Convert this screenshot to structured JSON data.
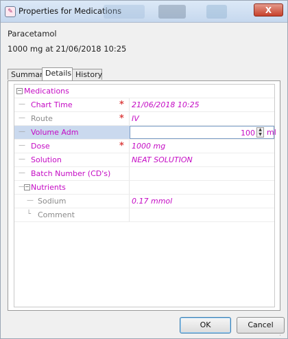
{
  "window": {
    "title": "Properties for Medications",
    "close_label": "X",
    "app_icon": "properties-icon"
  },
  "header": {
    "drug_name": "Paracetamol",
    "dose_summary": "1000 mg at 21/06/2018 10:25"
  },
  "tabs": [
    {
      "label": "Summary",
      "active": false
    },
    {
      "label": "Details",
      "active": true
    },
    {
      "label": "History",
      "active": false
    }
  ],
  "grid": {
    "medications_label": "Medications",
    "rows": [
      {
        "label": "Chart Time",
        "required": true,
        "value": "21/06/2018 10:25",
        "enabled": true
      },
      {
        "label": "Route",
        "required": true,
        "value": "IV",
        "enabled": false
      },
      {
        "label": "Volume Adm",
        "required": false,
        "value": "100",
        "unit": "ml",
        "enabled": true,
        "selected": true
      },
      {
        "label": "Dose",
        "required": true,
        "value": "1000 mg",
        "enabled": true
      },
      {
        "label": "Solution",
        "required": false,
        "value": "NEAT SOLUTION",
        "enabled": true
      },
      {
        "label": "Batch Number (CD's)",
        "required": false,
        "value": "",
        "enabled": true
      }
    ],
    "nutrients_label": "Nutrients",
    "nutrient_rows": [
      {
        "label": "Sodium",
        "value": "0.17 mmol",
        "enabled": false
      },
      {
        "label": "Comment",
        "value": "",
        "enabled": false
      }
    ],
    "required_marker": "*",
    "collapse_glyph": "⊟"
  },
  "buttons": {
    "ok": "OK",
    "cancel": "Cancel"
  },
  "colors": {
    "label": "#c40ac4",
    "disabled_label": "#8a8a8a",
    "required": "#dd4444",
    "selection": "#cad9ee"
  }
}
